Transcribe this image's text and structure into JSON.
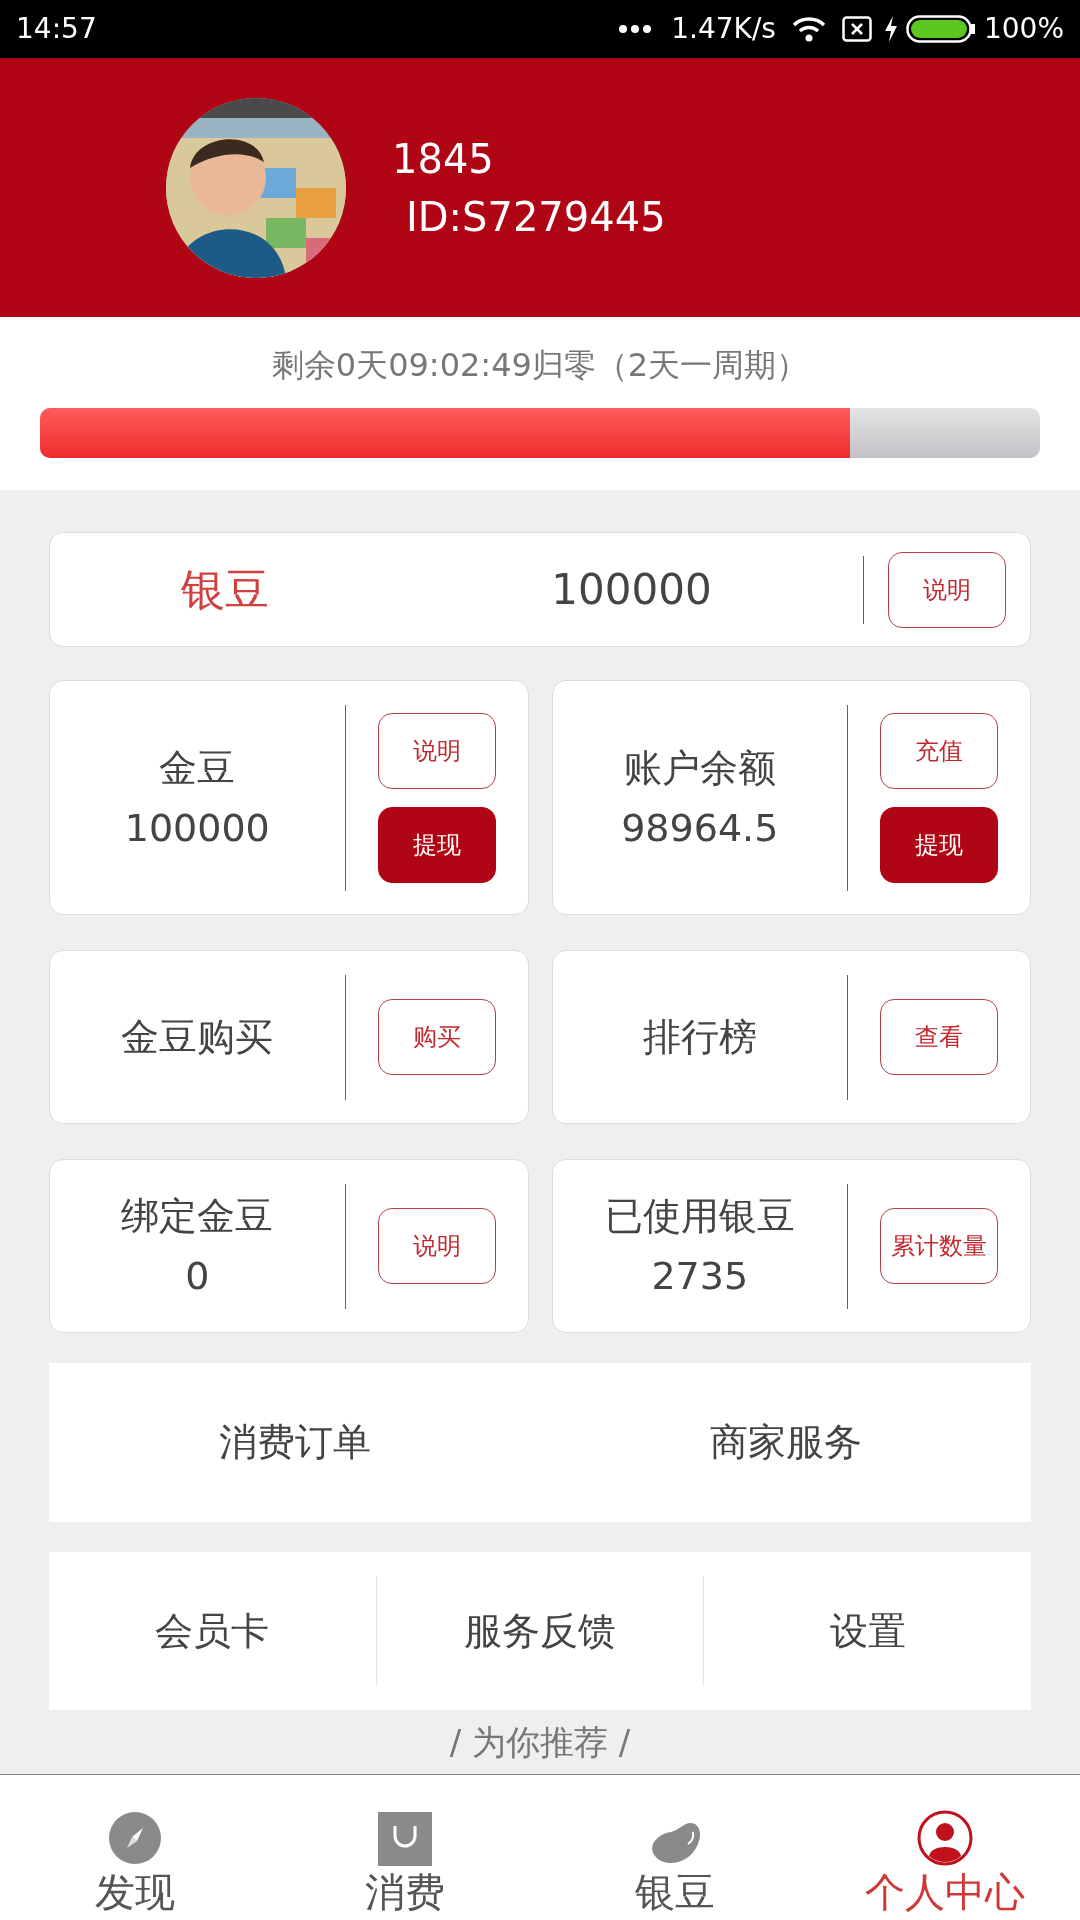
{
  "status_bar": {
    "time": "14:57",
    "speed": "1.47K/s",
    "battery": "100%"
  },
  "profile": {
    "phone": "1845",
    "id": "ID:S7279445"
  },
  "countdown": {
    "text": "剩余0天09:02:49归零（2天一周期）",
    "level": 0.81
  },
  "silver": {
    "label": "银豆",
    "value": "100000",
    "button": "说明"
  },
  "cards": [
    {
      "label": "金豆",
      "value": "100000",
      "buttons": [
        {
          "label": "说明",
          "kind": "outline"
        },
        {
          "label": "提现",
          "kind": "filled"
        }
      ]
    },
    {
      "label": "账户余额",
      "value": "98964.5",
      "buttons": [
        {
          "label": "充值",
          "kind": "outline"
        },
        {
          "label": "提现",
          "kind": "filled"
        }
      ]
    },
    {
      "label": "金豆购买",
      "buttons": [
        {
          "label": "购买",
          "kind": "outline"
        }
      ]
    },
    {
      "label": "排行榜",
      "buttons": [
        {
          "label": "查看",
          "kind": "outline"
        }
      ]
    },
    {
      "label": "绑定金豆",
      "value": "0",
      "buttons": [
        {
          "label": "说明",
          "kind": "outline"
        }
      ]
    },
    {
      "label": "已使用银豆",
      "value": "2735",
      "buttons": [
        {
          "label": "累计数量",
          "kind": "outline"
        }
      ]
    }
  ],
  "menu_row_1": [
    "消费订单",
    "商家服务"
  ],
  "menu_row_2": [
    "会员卡",
    "服务反馈",
    "设置"
  ],
  "recommend": "/ 为你推荐 /",
  "nav": [
    {
      "label": "发现",
      "selected": false
    },
    {
      "label": "消费",
      "selected": false
    },
    {
      "label": "银豆",
      "selected": false
    },
    {
      "label": "个人中心",
      "selected": true
    }
  ]
}
